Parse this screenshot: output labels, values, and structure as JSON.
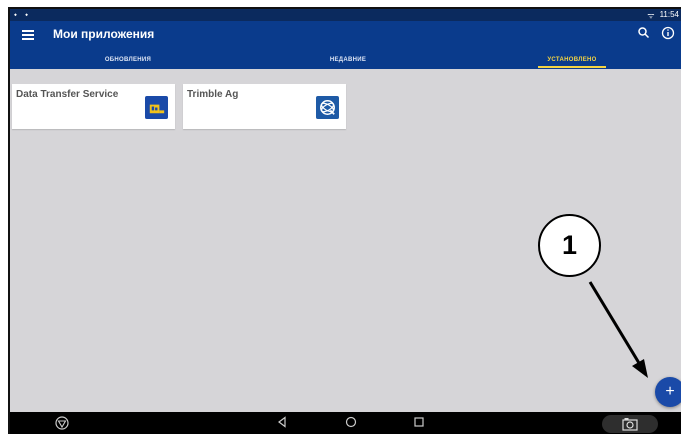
{
  "status_bar": {
    "left_icons": "⬩ ⬩",
    "signal": "ᯤ",
    "time": "11:54"
  },
  "app_bar": {
    "title": "Мои приложения"
  },
  "tabs": [
    {
      "label": "ОБНОВЛЕНИЯ",
      "active": false
    },
    {
      "label": "НЕДАВНИЕ",
      "active": false
    },
    {
      "label": "УСТАНОВЛЕНО",
      "active": true
    }
  ],
  "apps": [
    {
      "name": "Data Transfer Service",
      "icon": "data-transfer-icon",
      "icon_color": "#1a4aa8",
      "accent": "#f2c21b"
    },
    {
      "name": "Trimble Ag",
      "icon": "trimble-globe-icon",
      "icon_color": "#1e5aa6"
    }
  ],
  "fab": {
    "label": "+",
    "color": "#1a4aa8"
  },
  "callout": {
    "label": "1"
  },
  "colors": {
    "app_bar": "#0a3b8c",
    "status_bar": "#0b2a5e",
    "active_tab": "#f5d442",
    "background": "#d6d5d8"
  }
}
